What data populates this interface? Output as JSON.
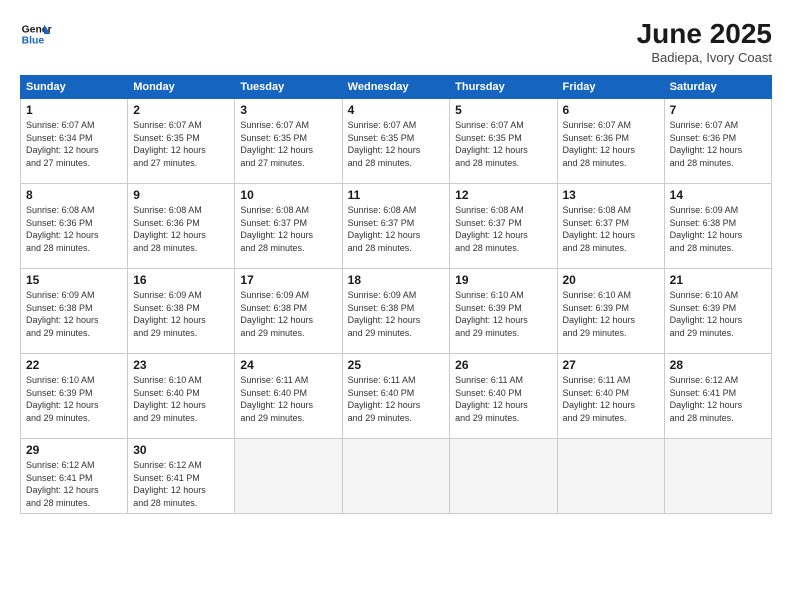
{
  "logo": {
    "line1": "General",
    "line2": "Blue"
  },
  "title": "June 2025",
  "location": "Badiepa, Ivory Coast",
  "weekdays": [
    "Sunday",
    "Monday",
    "Tuesday",
    "Wednesday",
    "Thursday",
    "Friday",
    "Saturday"
  ],
  "weeks": [
    [
      {
        "day": "1",
        "detail": "Sunrise: 6:07 AM\nSunset: 6:34 PM\nDaylight: 12 hours\nand 27 minutes."
      },
      {
        "day": "2",
        "detail": "Sunrise: 6:07 AM\nSunset: 6:35 PM\nDaylight: 12 hours\nand 27 minutes."
      },
      {
        "day": "3",
        "detail": "Sunrise: 6:07 AM\nSunset: 6:35 PM\nDaylight: 12 hours\nand 27 minutes."
      },
      {
        "day": "4",
        "detail": "Sunrise: 6:07 AM\nSunset: 6:35 PM\nDaylight: 12 hours\nand 28 minutes."
      },
      {
        "day": "5",
        "detail": "Sunrise: 6:07 AM\nSunset: 6:35 PM\nDaylight: 12 hours\nand 28 minutes."
      },
      {
        "day": "6",
        "detail": "Sunrise: 6:07 AM\nSunset: 6:36 PM\nDaylight: 12 hours\nand 28 minutes."
      },
      {
        "day": "7",
        "detail": "Sunrise: 6:07 AM\nSunset: 6:36 PM\nDaylight: 12 hours\nand 28 minutes."
      }
    ],
    [
      {
        "day": "8",
        "detail": "Sunrise: 6:08 AM\nSunset: 6:36 PM\nDaylight: 12 hours\nand 28 minutes."
      },
      {
        "day": "9",
        "detail": "Sunrise: 6:08 AM\nSunset: 6:36 PM\nDaylight: 12 hours\nand 28 minutes."
      },
      {
        "day": "10",
        "detail": "Sunrise: 6:08 AM\nSunset: 6:37 PM\nDaylight: 12 hours\nand 28 minutes."
      },
      {
        "day": "11",
        "detail": "Sunrise: 6:08 AM\nSunset: 6:37 PM\nDaylight: 12 hours\nand 28 minutes."
      },
      {
        "day": "12",
        "detail": "Sunrise: 6:08 AM\nSunset: 6:37 PM\nDaylight: 12 hours\nand 28 minutes."
      },
      {
        "day": "13",
        "detail": "Sunrise: 6:08 AM\nSunset: 6:37 PM\nDaylight: 12 hours\nand 28 minutes."
      },
      {
        "day": "14",
        "detail": "Sunrise: 6:09 AM\nSunset: 6:38 PM\nDaylight: 12 hours\nand 28 minutes."
      }
    ],
    [
      {
        "day": "15",
        "detail": "Sunrise: 6:09 AM\nSunset: 6:38 PM\nDaylight: 12 hours\nand 29 minutes."
      },
      {
        "day": "16",
        "detail": "Sunrise: 6:09 AM\nSunset: 6:38 PM\nDaylight: 12 hours\nand 29 minutes."
      },
      {
        "day": "17",
        "detail": "Sunrise: 6:09 AM\nSunset: 6:38 PM\nDaylight: 12 hours\nand 29 minutes."
      },
      {
        "day": "18",
        "detail": "Sunrise: 6:09 AM\nSunset: 6:38 PM\nDaylight: 12 hours\nand 29 minutes."
      },
      {
        "day": "19",
        "detail": "Sunrise: 6:10 AM\nSunset: 6:39 PM\nDaylight: 12 hours\nand 29 minutes."
      },
      {
        "day": "20",
        "detail": "Sunrise: 6:10 AM\nSunset: 6:39 PM\nDaylight: 12 hours\nand 29 minutes."
      },
      {
        "day": "21",
        "detail": "Sunrise: 6:10 AM\nSunset: 6:39 PM\nDaylight: 12 hours\nand 29 minutes."
      }
    ],
    [
      {
        "day": "22",
        "detail": "Sunrise: 6:10 AM\nSunset: 6:39 PM\nDaylight: 12 hours\nand 29 minutes."
      },
      {
        "day": "23",
        "detail": "Sunrise: 6:10 AM\nSunset: 6:40 PM\nDaylight: 12 hours\nand 29 minutes."
      },
      {
        "day": "24",
        "detail": "Sunrise: 6:11 AM\nSunset: 6:40 PM\nDaylight: 12 hours\nand 29 minutes."
      },
      {
        "day": "25",
        "detail": "Sunrise: 6:11 AM\nSunset: 6:40 PM\nDaylight: 12 hours\nand 29 minutes."
      },
      {
        "day": "26",
        "detail": "Sunrise: 6:11 AM\nSunset: 6:40 PM\nDaylight: 12 hours\nand 29 minutes."
      },
      {
        "day": "27",
        "detail": "Sunrise: 6:11 AM\nSunset: 6:40 PM\nDaylight: 12 hours\nand 29 minutes."
      },
      {
        "day": "28",
        "detail": "Sunrise: 6:12 AM\nSunset: 6:41 PM\nDaylight: 12 hours\nand 28 minutes."
      }
    ],
    [
      {
        "day": "29",
        "detail": "Sunrise: 6:12 AM\nSunset: 6:41 PM\nDaylight: 12 hours\nand 28 minutes."
      },
      {
        "day": "30",
        "detail": "Sunrise: 6:12 AM\nSunset: 6:41 PM\nDaylight: 12 hours\nand 28 minutes."
      },
      {
        "day": "",
        "detail": ""
      },
      {
        "day": "",
        "detail": ""
      },
      {
        "day": "",
        "detail": ""
      },
      {
        "day": "",
        "detail": ""
      },
      {
        "day": "",
        "detail": ""
      }
    ]
  ]
}
